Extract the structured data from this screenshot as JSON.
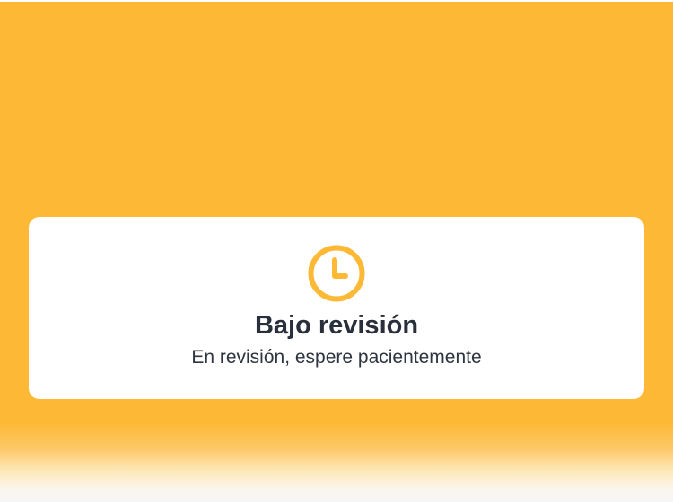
{
  "review_status": {
    "icon": "clock-icon",
    "title": "Bajo revisión",
    "message": "En revisión, espere pacientemente"
  },
  "colors": {
    "accent": "#fdb935",
    "card_background": "#ffffff",
    "text_primary": "#2a303b"
  }
}
